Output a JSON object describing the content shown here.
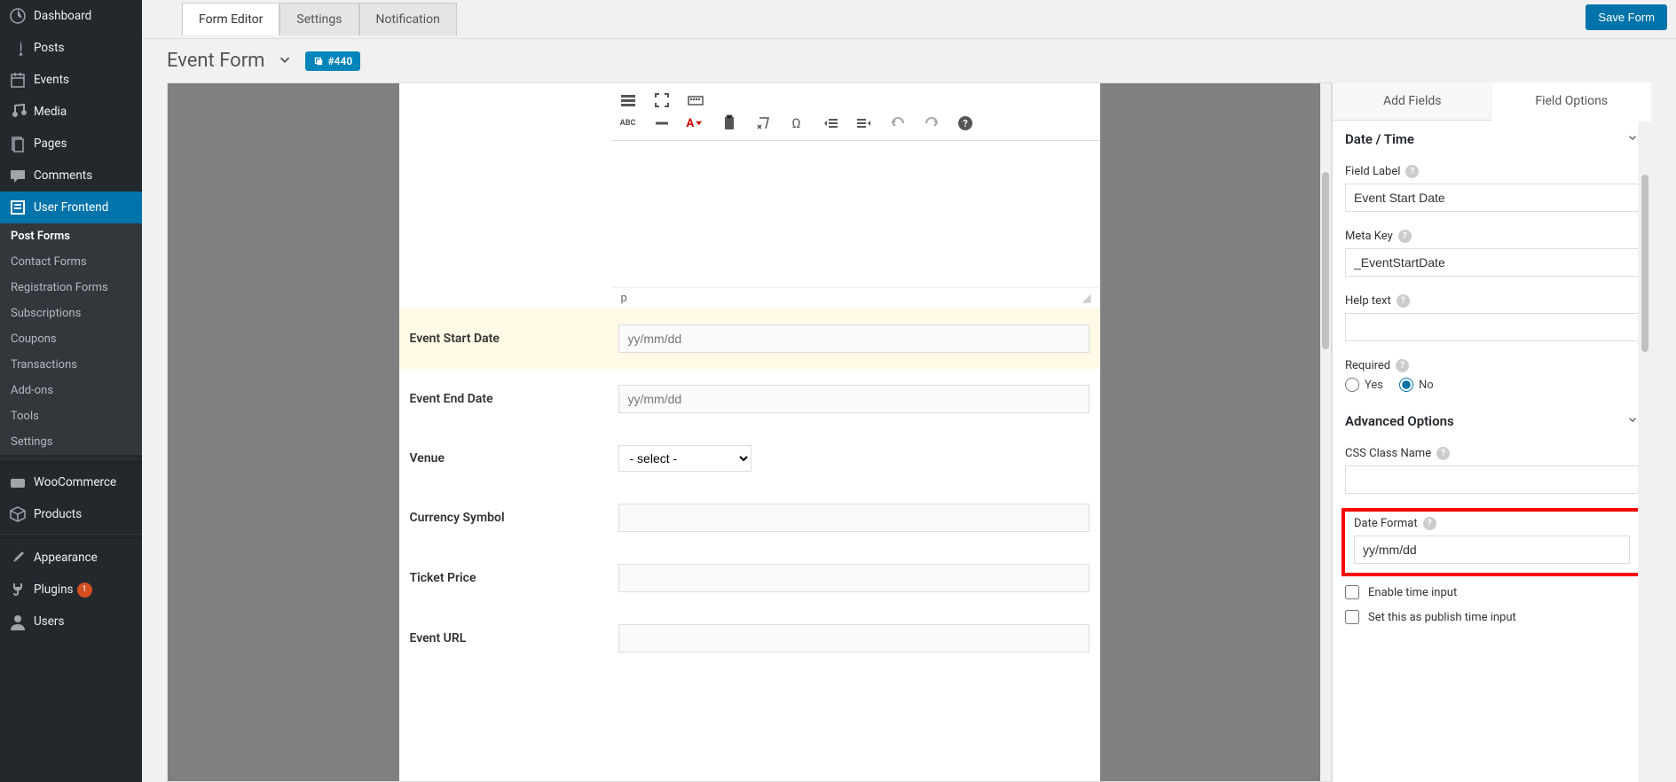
{
  "sidebar": {
    "items": [
      {
        "label": "Dashboard",
        "icon": "dashboard"
      },
      {
        "label": "Posts",
        "icon": "pin"
      },
      {
        "label": "Events",
        "icon": "calendar"
      },
      {
        "label": "Media",
        "icon": "media"
      },
      {
        "label": "Pages",
        "icon": "page"
      },
      {
        "label": "Comments",
        "icon": "comment"
      },
      {
        "label": "User Frontend",
        "icon": "form",
        "active": true
      },
      {
        "label": "WooCommerce",
        "icon": "woo"
      },
      {
        "label": "Products",
        "icon": "product"
      },
      {
        "label": "Appearance",
        "icon": "brush"
      },
      {
        "label": "Plugins",
        "icon": "plug",
        "badge": "1"
      },
      {
        "label": "Users",
        "icon": "user"
      }
    ],
    "submenu": [
      {
        "label": "Post Forms",
        "active": true
      },
      {
        "label": "Contact Forms"
      },
      {
        "label": "Registration Forms"
      },
      {
        "label": "Subscriptions"
      },
      {
        "label": "Coupons"
      },
      {
        "label": "Transactions"
      },
      {
        "label": "Add-ons"
      },
      {
        "label": "Tools"
      },
      {
        "label": "Settings"
      }
    ]
  },
  "topbar": {
    "tabs": [
      {
        "label": "Form Editor",
        "active": true
      },
      {
        "label": "Settings"
      },
      {
        "label": "Notification"
      }
    ],
    "save_label": "Save Form"
  },
  "form": {
    "title": "Event Form",
    "id_badge": "#440",
    "editor_path": "p",
    "fields": [
      {
        "label": "Event Start Date",
        "placeholder": "yy/mm/dd",
        "type": "text",
        "highlighted": true
      },
      {
        "label": "Event End Date",
        "placeholder": "yy/mm/dd",
        "type": "text"
      },
      {
        "label": "Venue",
        "placeholder": "- select -",
        "type": "select"
      },
      {
        "label": "Currency Symbol",
        "placeholder": "",
        "type": "text"
      },
      {
        "label": "Ticket Price",
        "placeholder": "",
        "type": "text"
      },
      {
        "label": "Event URL",
        "placeholder": "",
        "type": "text"
      }
    ]
  },
  "right": {
    "tabs": [
      {
        "label": "Add Fields"
      },
      {
        "label": "Field Options",
        "active": true
      }
    ],
    "section_title": "Date / Time",
    "field_label_label": "Field Label",
    "field_label_value": "Event Start Date",
    "meta_key_label": "Meta Key",
    "meta_key_value": "_EventStartDate",
    "help_text_label": "Help text",
    "help_text_value": "",
    "required_label": "Required",
    "required_yes": "Yes",
    "required_no": "No",
    "advanced_label": "Advanced Options",
    "css_label": "CSS Class Name",
    "css_value": "",
    "date_format_label": "Date Format",
    "date_format_value": "yy/mm/dd",
    "enable_time_label": "Enable time input",
    "publish_time_label": "Set this as publish time input"
  }
}
